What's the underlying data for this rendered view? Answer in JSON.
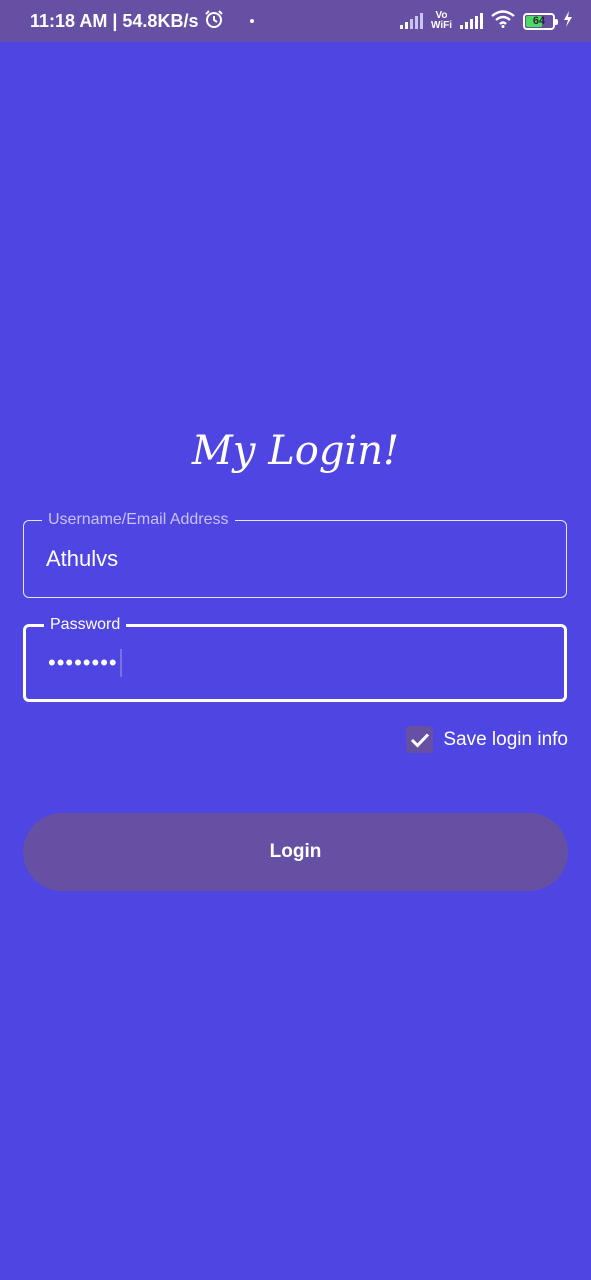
{
  "status_bar": {
    "time_speed": "11:18 AM | 54.8KB/s",
    "wifi_tag": "Vo\nWiFi",
    "battery_level": "64",
    "battery_fraction": 0.64,
    "icons": [
      "alarm-icon",
      "signal-icon",
      "vowifi-icon",
      "wifi-icon",
      "battery-icon",
      "charging-icon"
    ]
  },
  "title": "My Login!",
  "username_field": {
    "label": "Username/Email Address",
    "value": "Athulvs"
  },
  "password_field": {
    "label": "Password",
    "value": "••••••••"
  },
  "save_login": {
    "label": "Save login info",
    "checked": true
  },
  "login_button": {
    "label": "Login"
  },
  "colors": {
    "background": "#4e45e2",
    "accent": "#6650a4",
    "text": "#ffffff"
  }
}
